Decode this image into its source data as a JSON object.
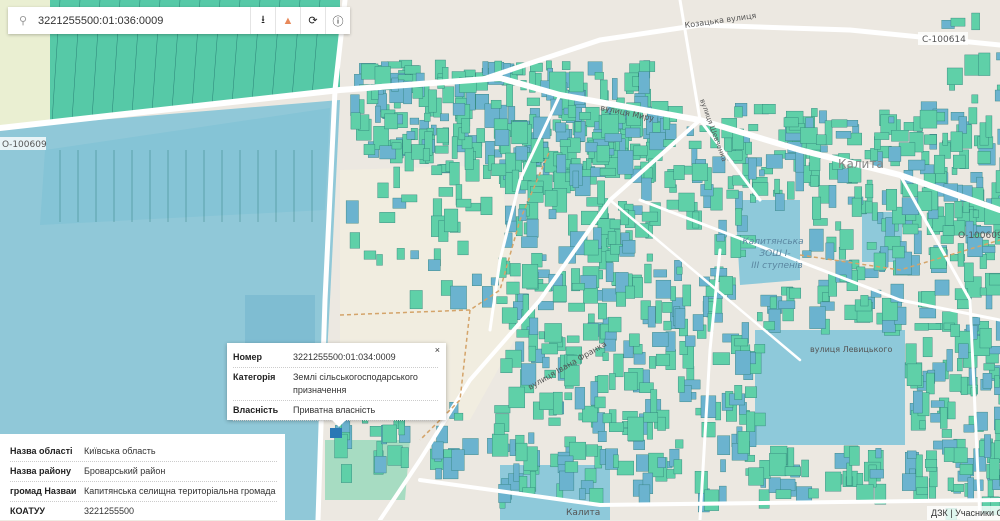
{
  "search": {
    "value": "3221255500:01:036:0009",
    "icons": [
      "search-icon",
      "download-icon",
      "warning-icon",
      "refresh-icon",
      "info-icon"
    ]
  },
  "popup": {
    "close": "×",
    "rows": [
      {
        "key": "Номер",
        "value": "3221255500:01:034:0009"
      },
      {
        "key": "Категорія",
        "value": "Землі сільськогосподарського призначення"
      },
      {
        "key": "Власність",
        "value": "Приватна власність"
      }
    ]
  },
  "info": {
    "rows": [
      {
        "key": "Назва області",
        "value": "Київська область"
      },
      {
        "key": "Назва району",
        "value": "Броварський район"
      },
      {
        "key": "громад Назваи",
        "value": "Капитянська селищна територіальна громада"
      },
      {
        "key": "КОАТУУ",
        "value": "3221255500"
      }
    ]
  },
  "attribution": "ДЗК | Учасники OpenStreetMap",
  "map_labels": {
    "road1": "О-100609",
    "road2": "С-100614",
    "road3": "О-100609",
    "street_myru": "вулиця Миру",
    "street_kozatska": "Козацька вулиця",
    "street_shevchenka": "вулиця Шевченка",
    "street_lelyukhorgo": "вулиця Левицького",
    "street_franka": "вулиця Івана Франка",
    "town": "Калита",
    "town2": "Калита",
    "school1": "Калитянська",
    "school2": "ЗОШ І-",
    "school3": "ІІІ ступенів"
  },
  "colors": {
    "parcel_green": "#5fd0a8",
    "parcel_blue": "#6bb3cf",
    "water_area": "#8ec9da",
    "road": "#ffffff",
    "land": "#efebe4"
  }
}
